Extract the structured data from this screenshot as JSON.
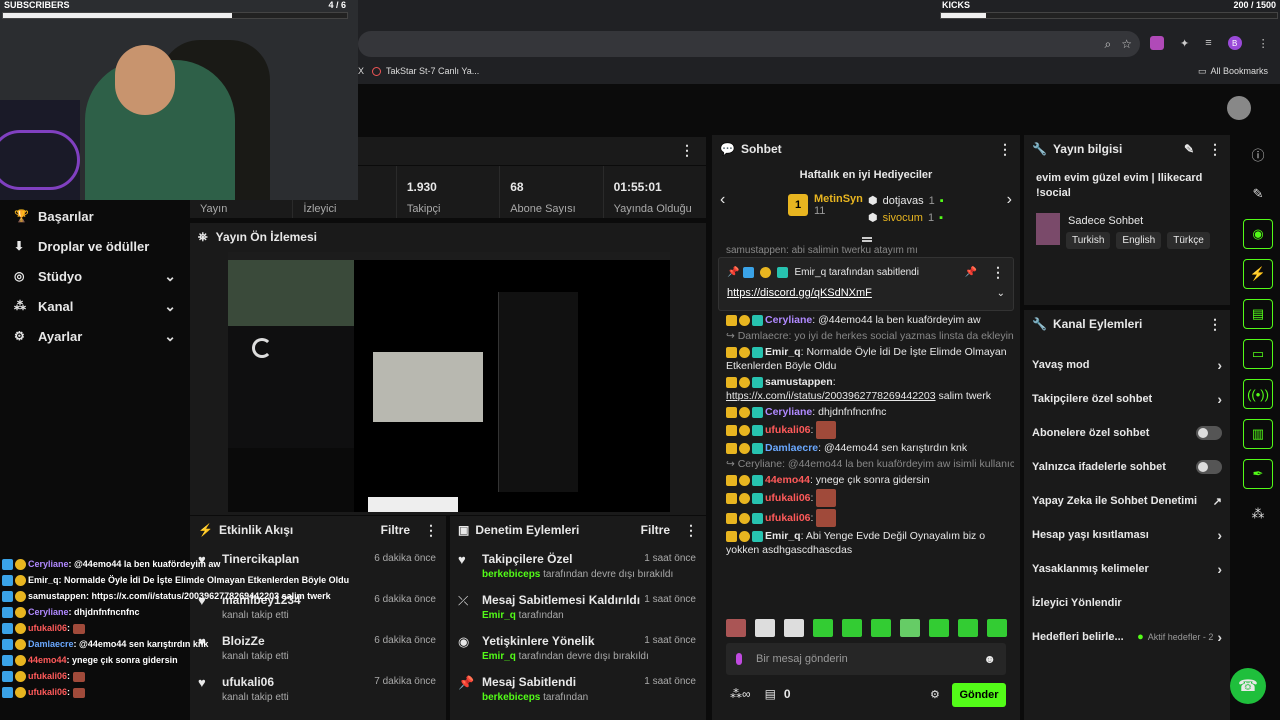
{
  "browser": {
    "bookmark_tab": "TakStar St-7 Canlı Ya...",
    "bookmark_partial": "X",
    "all_bookmarks": "All Bookmarks",
    "profile_letter": "B"
  },
  "overlay": {
    "subscribers_label": "SUBSCRIBERS",
    "subscribers_count": "4 / 6",
    "subscribers_progress": 0.667,
    "kicks_label": "KICKS",
    "kicks_count": "200 / 1500",
    "kicks_progress": 0.133,
    "chat": [
      {
        "user": "Ceryliane",
        "text": ": @44emo44 la ben kuafördeyim aw",
        "color": "purple"
      },
      {
        "user": "Emir_q",
        "text": ": Normalde Öyle İdi De İşte Elimde Olmayan Etkenlerden Böyle Oldu",
        "color": "white"
      },
      {
        "user": "samustappen",
        "text": ": https://x.com/i/status/2003962778269442203 salim twerk",
        "color": "white"
      },
      {
        "user": "Ceryliane",
        "text": ": dhjdnfnfncnfnc",
        "color": "purple"
      },
      {
        "user": "ufukali06",
        "text": ":",
        "color": "red"
      },
      {
        "user": "Damlaecre",
        "text": ": @44emo44 sen karıştırdın knk",
        "color": "blue"
      },
      {
        "user": "44emo44",
        "text": ": ynege çık sonra gidersin",
        "color": "red"
      },
      {
        "user": "ufukali06",
        "text": ":",
        "color": "red"
      },
      {
        "user": "ufukali06",
        "text": ":",
        "color": "red"
      }
    ]
  },
  "nav": {
    "items": [
      {
        "label": "Başarılar",
        "icon": "trophy-icon",
        "chevron": false
      },
      {
        "label": "Droplar ve ödüller",
        "icon": "drops-icon",
        "chevron": false
      },
      {
        "label": "Stüdyo",
        "icon": "studio-icon",
        "chevron": true
      },
      {
        "label": "Kanal",
        "icon": "channel-icon",
        "chevron": true
      },
      {
        "label": "Ayarlar",
        "icon": "settings-icon",
        "chevron": true
      }
    ]
  },
  "stats": [
    {
      "value": "",
      "label": "Yayın"
    },
    {
      "value": "",
      "label": "İzleyici"
    },
    {
      "value": "1.930",
      "label": "Takipçi"
    },
    {
      "value": "68",
      "label": "Abone Sayısı"
    },
    {
      "value": "01:55:01",
      "label": "Yayında Olduğu"
    }
  ],
  "preview": {
    "title": "Yayın Ön İzlemesi"
  },
  "activity": {
    "title": "Etkinlik Akışı",
    "filter": "Filtre",
    "items": [
      {
        "name": "Tinercikaplan",
        "sub": "",
        "time": "6 dakika önce"
      },
      {
        "name": "mamibey1234",
        "sub": "kanalı takip etti",
        "time": "6 dakika önce"
      },
      {
        "name": "BloizZe",
        "sub": "kanalı takip etti",
        "time": "6 dakika önce"
      },
      {
        "name": "ufukali06",
        "sub": "kanalı takip etti",
        "time": "7 dakika önce"
      }
    ]
  },
  "moderation": {
    "title": "Denetim Eylemleri",
    "filter": "Filtre",
    "items": [
      {
        "name": "Takipçilere Özel",
        "user": "berkebiceps",
        "sub": " tarafından devre dışı bırakıldı",
        "time": "1 saat önce",
        "icon": "heart-icon"
      },
      {
        "name": "Mesaj Sabitlemesi Kaldırıldı",
        "user": "Emir_q",
        "sub": " tarafından",
        "time": "1 saat önce",
        "icon": "unpin-icon"
      },
      {
        "name": "Yetişkinlere Yönelik",
        "user": "Emir_q",
        "sub": " tarafından devre dışı bırakıldı",
        "time": "1 saat önce",
        "icon": "eye-icon"
      },
      {
        "name": "Mesaj Sabitlendi",
        "user": "berkebiceps",
        "sub": " tarafından",
        "time": "1 saat önce",
        "icon": "pin-icon"
      }
    ]
  },
  "chat": {
    "title": "Sohbet",
    "gifters_title": "Haftalık en iyi Hediyeciler",
    "top_gifter": {
      "name": "MetinSyn",
      "count": "11"
    },
    "gifters": [
      {
        "name": "dotjavas",
        "count": "1"
      },
      {
        "name": "sivocum",
        "count": "1"
      }
    ],
    "partial_top": "samustappen: abi salimin twerku atayım mı",
    "pinned_by": "Emir_q tarafından sabitlendi",
    "pinned_link": "https://discord.gg/qKSdNXmF",
    "messages": [
      {
        "user": "Ceryliane",
        "color": "purple",
        "text": ": @44emo44 la ben kuafördeyim aw"
      },
      {
        "reply": "Damlaecre: yo iyi de herkes social yazmas linsta da ekleyin b..."
      },
      {
        "user": "Emir_q",
        "color": "white",
        "text": ": Normalde Öyle İdi De İşte Elimde Olmayan Etkenlerden Böyle Oldu"
      },
      {
        "user": "samustappen",
        "color": "white",
        "text": ":",
        "link": "https://x.com/i/status/2003962778269442203",
        "after": " salim twerk"
      },
      {
        "user": "Ceryliane",
        "color": "purple",
        "text": ": dhjdnfnfncnfnc"
      },
      {
        "user": "ufukali06",
        "color": "red",
        "text": ":",
        "emote": true
      },
      {
        "user": "Damlaecre",
        "color": "blue",
        "text": ": @44emo44 sen karıştırdın knk"
      },
      {
        "reply": "Ceryliane: @44emo44 la ben kuafördeyim aw isimli kullanıcıy..."
      },
      {
        "user": "44emo44",
        "color": "red",
        "text": ": ynege çık sonra gidersin"
      },
      {
        "user": "ufukali06",
        "color": "red",
        "text": ":",
        "emote": true
      },
      {
        "user": "ufukali06",
        "color": "red",
        "text": ":",
        "emote": true
      },
      {
        "user": "Emir_q",
        "color": "white",
        "text": ": Abi Yenge Evde Değil Oynayalım biz o yokken asdhgascdhascdas"
      }
    ],
    "input_placeholder": "Bir mesaj gönderin",
    "viewer_count": "0",
    "send_label": "Gönder"
  },
  "stream_info": {
    "title": "Yayın bilgisi",
    "stream_title": "evim evim güzel evim | llikecard !social",
    "category": "Sadece Sohbet",
    "tags": [
      "Turkish",
      "English",
      "Türkçe"
    ]
  },
  "channel_actions": {
    "title": "Kanal Eylemleri",
    "items": [
      {
        "label": "Yavaş mod",
        "kind": "chevron"
      },
      {
        "label": "Takipçilere özel sohbet",
        "kind": "chevron"
      },
      {
        "label": "Abonelere özel sohbet",
        "kind": "toggle"
      },
      {
        "label": "Yalnızca ifadelerle sohbet",
        "kind": "toggle"
      },
      {
        "label": "Yapay Zeka ile Sohbet Denetimi",
        "kind": "external"
      },
      {
        "label": "Hesap yaşı kısıtlaması",
        "kind": "chevron"
      },
      {
        "label": "Yasaklanmış kelimeler",
        "kind": "chevron"
      },
      {
        "label": "İzleyici Yönlendir",
        "kind": "none"
      },
      {
        "label": "Hedefleri belirle...",
        "kind": "chevron",
        "extra": "Aktif hedefler - 2"
      }
    ]
  },
  "colors": {
    "accent": "#53fc18",
    "panel": "#1a1a1a",
    "bg": "#0b0b0b"
  }
}
